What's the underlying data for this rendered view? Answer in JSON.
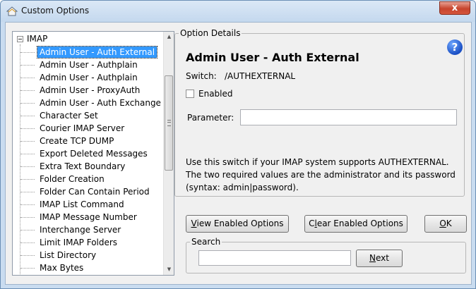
{
  "window": {
    "title": "Custom Options",
    "close_glyph": "x"
  },
  "tree": {
    "root_label": "IMAP",
    "items": [
      "Admin User - Auth External",
      "Admin User - Authplain",
      "Admin User - Authplain",
      "Admin User - ProxyAuth",
      "Admin User - Auth Exchange",
      "Character Set",
      "Courier IMAP Server",
      "Create TCP DUMP",
      "Export Deleted Messages",
      "Extra Text Boundary",
      "Folder Creation",
      "Folder Can Contain Period",
      "IMAP List Command",
      "IMAP Message Number",
      "Interchange Server",
      "Limit IMAP Folders",
      "List Directory",
      "Max Bytes"
    ],
    "selected_index": 0
  },
  "details": {
    "legend": "Option Details",
    "heading": "Admin User - Auth External",
    "switch_label": "Switch:",
    "switch_value": "/AUTHEXTERNAL",
    "enabled_label": "Enabled",
    "enabled_checked": false,
    "parameter_label": "Parameter:",
    "parameter_value": "",
    "description": "Use this switch if your IMAP system supports AUTHEXTERNAL. The two required values are the administrator and its password (syntax: admin|password).",
    "help_glyph": "?"
  },
  "buttons": {
    "view_prefix": "",
    "view_mnemonic": "V",
    "view_rest": "iew Enabled Options",
    "clear_prefix": "C",
    "clear_mnemonic": "l",
    "clear_rest": "ear Enabled Options",
    "ok_mnemonic": "O",
    "ok_rest": "K",
    "next_mnemonic": "N",
    "next_rest": "ext"
  },
  "search": {
    "legend": "Search",
    "value": ""
  },
  "icons": {
    "app": "window-icon",
    "help": "help-icon",
    "close": "close-icon",
    "scroll_up": "chevron-up-icon",
    "scroll_down": "chevron-down-icon"
  },
  "colors": {
    "selection": "#3399ff",
    "help": "#1a4fc4",
    "close": "#c7442d"
  }
}
